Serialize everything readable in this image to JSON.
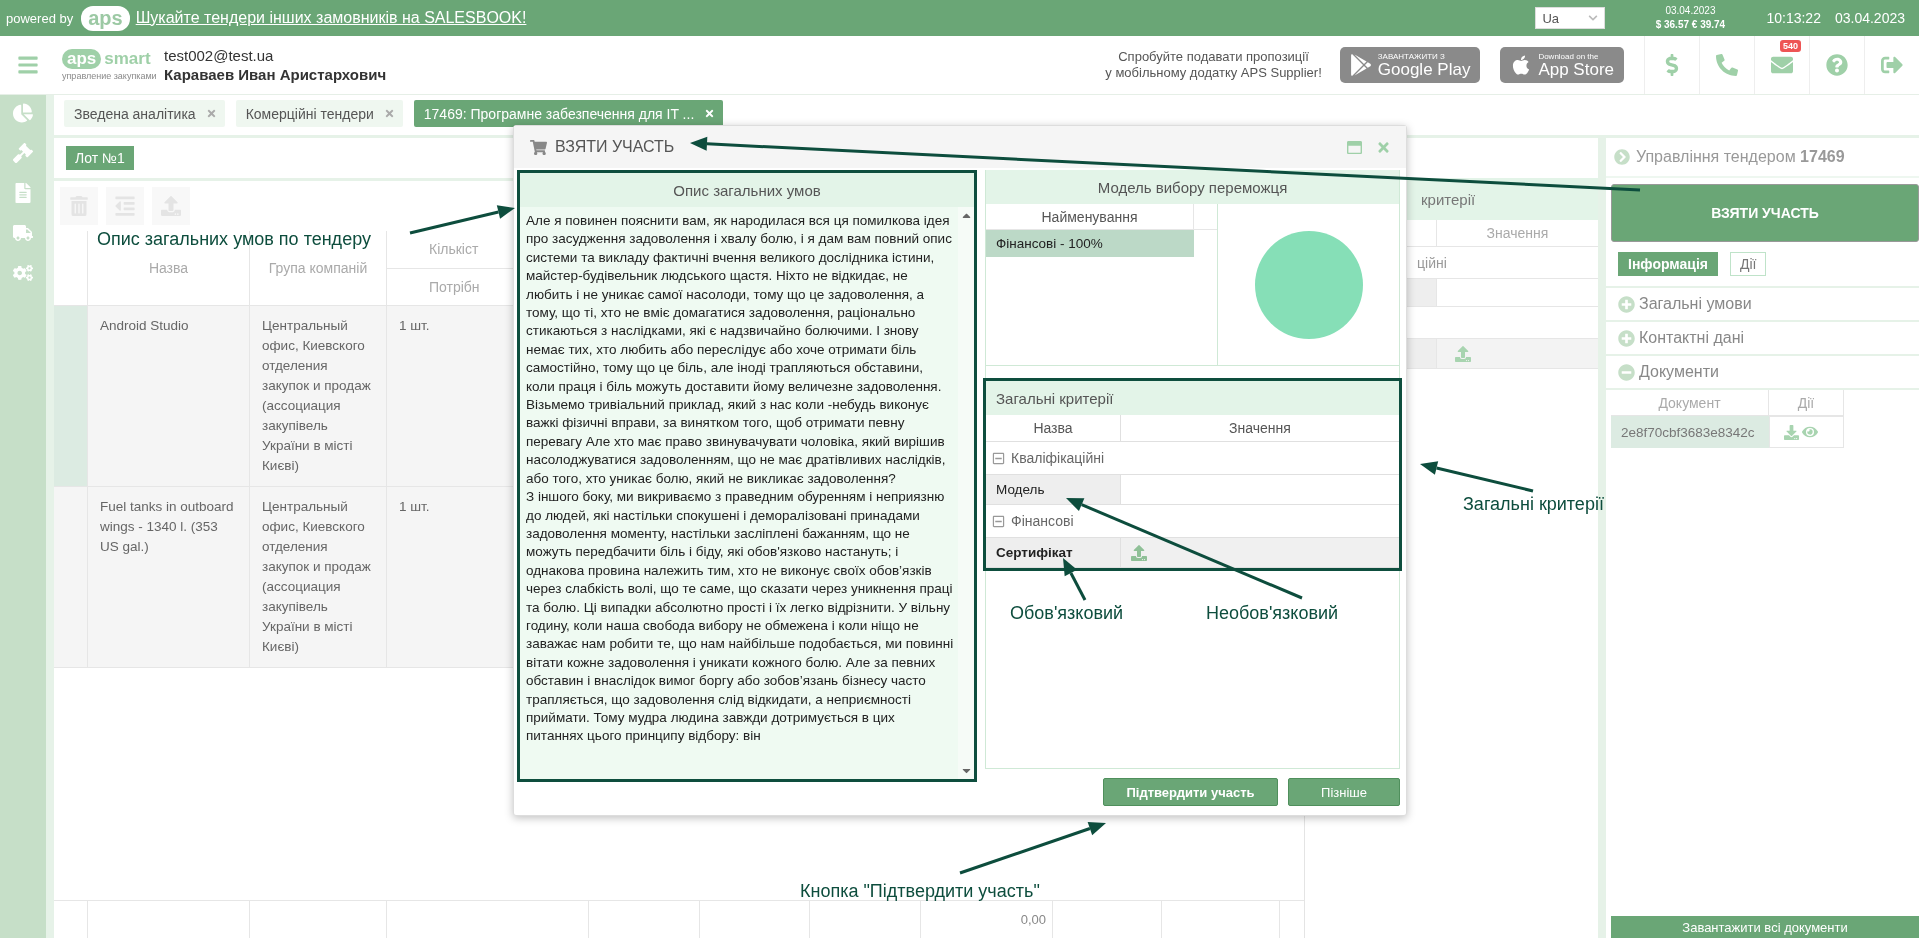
{
  "top_bar": {
    "powered_by": "powered by",
    "logo": "aps",
    "link": "Шукайте тендери інших замовників на SALESBOOK!",
    "language": "Ua",
    "rates_date": "03.04.2023",
    "rates": "$ 36.57 € 39.74",
    "time": "10:13:22",
    "date": "03.04.2023"
  },
  "header": {
    "logo_mark": "aps",
    "logo_word": "smart",
    "logo_subtitle": "управление закупками",
    "email": "test002@test.ua",
    "user_name": "Караваев Иван Аристархович",
    "promo": [
      "Спробуйте подавати пропозиції",
      "у мобільному додатку APS Supplier!"
    ],
    "store_buttons": [
      {
        "small": "ЗАВАНТАЖИТИ З",
        "big": "Google Play"
      },
      {
        "small": "Download on the",
        "big": "App Store"
      }
    ],
    "mail_badge": "540"
  },
  "tabs": [
    {
      "label": "Зведена аналітика",
      "selected": false
    },
    {
      "label": "Комерційні тендери",
      "selected": false
    },
    {
      "label": "17469: Програмне забезпечення для IT ...",
      "selected": true
    }
  ],
  "lot": {
    "tabs": [
      {
        "label": "Лот №1",
        "selected": true
      }
    ]
  },
  "items_table": {
    "columns": [
      {
        "label": "Назва"
      },
      {
        "label": "Група компаній"
      },
      {
        "label": "Кількіст",
        "sub": "Потрібн"
      }
    ],
    "rows": [
      {
        "name": "Android Studio",
        "group": "Центральный офис, Киевского отделения закупок и продаж (ассоциация закупівель України в місті Києві)",
        "quantity": "1 шт.",
        "selected": true
      },
      {
        "name": "Fuel tanks in outboard wings - 1340 l. (353 US gal.)",
        "group": "Центральный офис, Киевского отделения закупок и продаж (ассоциация закупівель України в місті Києві)",
        "quantity": "1 шт.",
        "selected": false
      }
    ],
    "total": "0,00"
  },
  "background_criteria": {
    "title": "критерії",
    "column": "Значення",
    "group": "ційні"
  },
  "modal": {
    "title": "ВЗЯТИ УЧАСТЬ",
    "description": {
      "title": "Опис загальних умов",
      "text": "Але я повинен пояснити вам, як народилася вся ця помилкова ідея про засудження задоволення і хвалу болю, і я дам вам повний опис системи та викладу фактичні вчення великого дослідника істини, майстер-будівельник людського щастя. Ніхто не відкидає, не любить і не уникає самої насолоди, тому що це задоволення, а тому, що ті, хто не вміє домагатися задоволення, раціонально стикаються з наслідками, які є надзвичайно болючими. І знову немає тих, хто любить або переслідує або хоче отримати біль самостійно, тому що це біль, але іноді трапляються обставини, коли праця і біль можуть доставити йому величезне задоволення. Візьмемо тривіальний приклад, який з нас коли -небудь виконує важкі фізичні вправи, за винятком того, щоб отримати певну перевагу Але хто має право звинувачувати чоловіка, який вирішив насолоджуватися задоволенням, що не має дратівливих наслідків, або того, хто уникає болю, який не викликає задоволення?\nЗ іншого боку, ми викриваємо з праведним обуренням і неприязню до людей, які настільки спокушені і деморалізовані принадами задоволення моменту, настільки засліплені бажанням, що не можуть передбачити біль і біду, які обов'язково настануть; і однакова провина належить тим, хто не виконує своїх обов’язків через слабкість волі, що те саме, що сказати через уникнення праці та болю. Ці випадки абсолютно прості і їх легко відрізнити. У вільну годину, коли наша свобода вибору не обмежена і коли ніщо не заважає нам робити те, що нам найбільше подобається, ми повинні вітати кожне задоволення і уникати кожного болю. Але за певних обставин і внаслідок вимог боргу або зобов’язань бізнесу часто трапляється, що задоволення слід відкидати, а неприємності приймати. Тому мудра людина завжди дотримується в цих питаннях цього принципу відбору: він"
    },
    "model": {
      "title": "Модель вибору переможця",
      "column": "Найменування",
      "rows": [
        {
          "label": "Фінансові - 100%",
          "selected": true
        }
      ]
    },
    "criteria": {
      "title": "Загальні критерії",
      "columns": [
        "Назва",
        "Значення"
      ],
      "groups": [
        {
          "name": "Кваліфікаційні",
          "expanded": true,
          "items": [
            {
              "name": "Модель",
              "required": false,
              "kind": "text"
            }
          ]
        },
        {
          "name": "Фінансові",
          "expanded": true,
          "items": [
            {
              "name": "Сертифікат",
              "required": true,
              "kind": "upload"
            }
          ]
        }
      ]
    },
    "buttons": [
      {
        "label": "Підтвердити участь",
        "primary": true
      },
      {
        "label": "Пізніше",
        "primary": false
      }
    ]
  },
  "right_panel": {
    "title": "Управління тендером **17469**",
    "action": "ВЗЯТИ УЧАСТЬ",
    "tabs": [
      {
        "label": "Інформація",
        "selected": true
      },
      {
        "label": "Дії",
        "selected": false
      }
    ],
    "sections": [
      {
        "label": "Загальні умови",
        "expanded": false
      },
      {
        "label": "Контактні дані",
        "expanded": false
      },
      {
        "label": "Документи",
        "expanded": true,
        "documents": {
          "columns": [
            "Документ",
            "Дії"
          ],
          "rows": [
            {
              "name": "2e8f70cbf3683e8342c"
            }
          ]
        }
      }
    ],
    "download_all": "Завантажити всі документи"
  },
  "annotations": [
    {
      "text": "Опис загальних умов по тендеру"
    },
    {
      "text": "Загальні критерії"
    },
    {
      "text": "Обов'язковий"
    },
    {
      "text": "Необов'язковий"
    },
    {
      "text": "Кнопка \"Підтвердити участь\""
    }
  ]
}
